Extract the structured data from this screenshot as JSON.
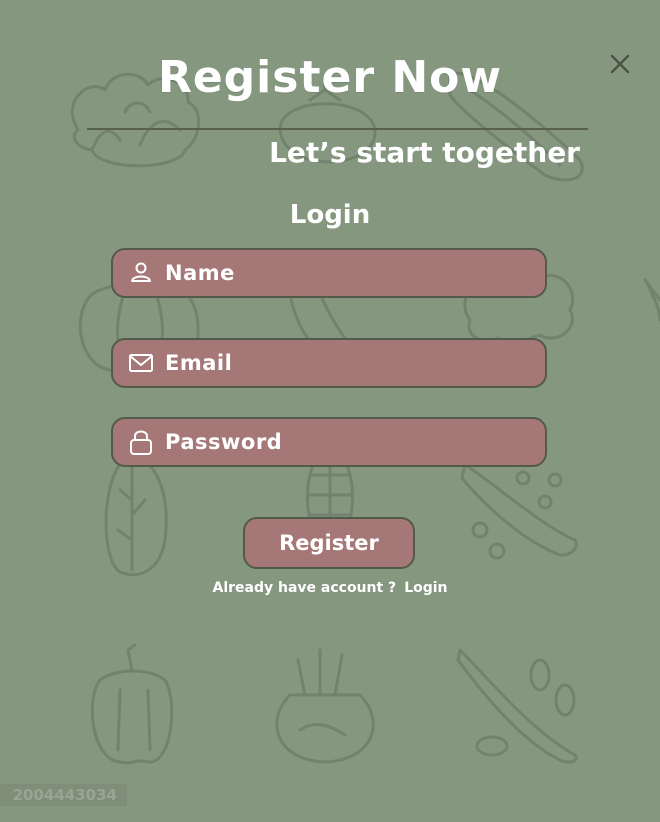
{
  "header": {
    "title": "Register Now",
    "subtitle": "Let’s start together",
    "close_icon": "close-icon"
  },
  "form": {
    "title": "Login",
    "fields": [
      {
        "placeholder": "Name",
        "icon": "user-icon",
        "value": ""
      },
      {
        "placeholder": "Email",
        "icon": "mail-icon",
        "value": ""
      },
      {
        "placeholder": "Password",
        "icon": "lock-icon",
        "value": ""
      }
    ],
    "submit_label": "Register"
  },
  "footer": {
    "prompt": "Already  have account ?",
    "link": "Login"
  },
  "watermark": "2004443034",
  "colors": {
    "background": "#86977f",
    "field_fill": "#a57877",
    "border": "#535a4b",
    "text": "#ffffff"
  }
}
